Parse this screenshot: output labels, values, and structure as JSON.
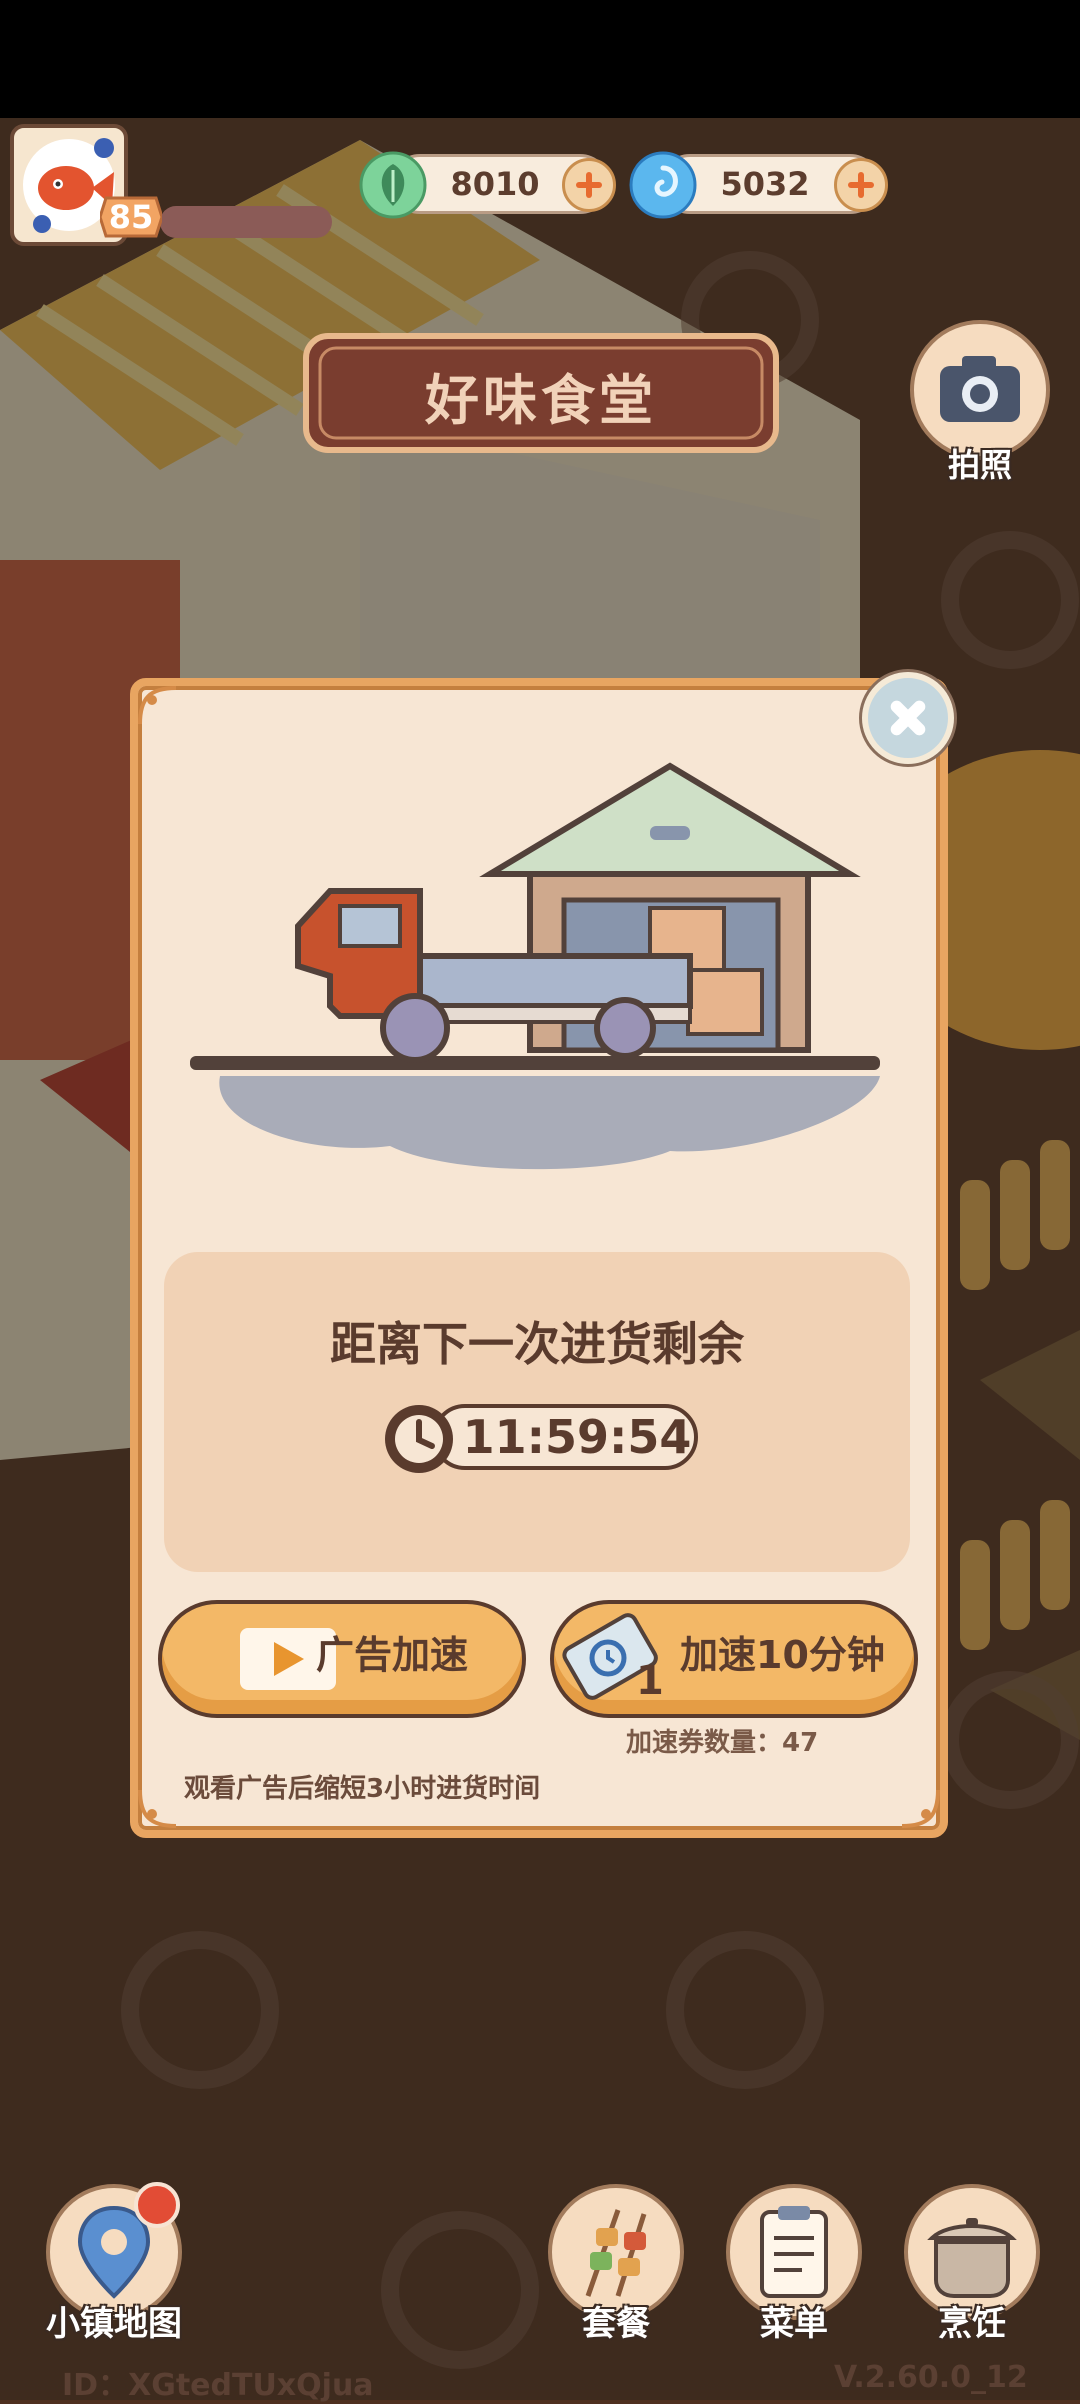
{
  "hud": {
    "level": "85",
    "currencies": [
      {
        "name": "leaf-gem",
        "value": "8010",
        "color": "#6ecb86"
      },
      {
        "name": "blue-swirl-gem",
        "value": "5032",
        "color": "#4aa8e6"
      }
    ],
    "camera_label": "拍照"
  },
  "shop_sign": "好味食堂",
  "dialog": {
    "title": "距离下一次进货剩余",
    "timer": "11:59:54",
    "ad_button": "广告加速",
    "speed_button": "加速10分钟",
    "ticket_count": "1",
    "voucher_text": "加速券数量：47",
    "hint": "观看广告后缩短3小时进货时间"
  },
  "nav": {
    "map": "小镇地图",
    "set_meal": "套餐",
    "menu": "菜单",
    "cooking": "烹饪"
  },
  "footer": {
    "id": "ID：XGtedTUxQjua",
    "version": "V.2.60.0_12"
  }
}
